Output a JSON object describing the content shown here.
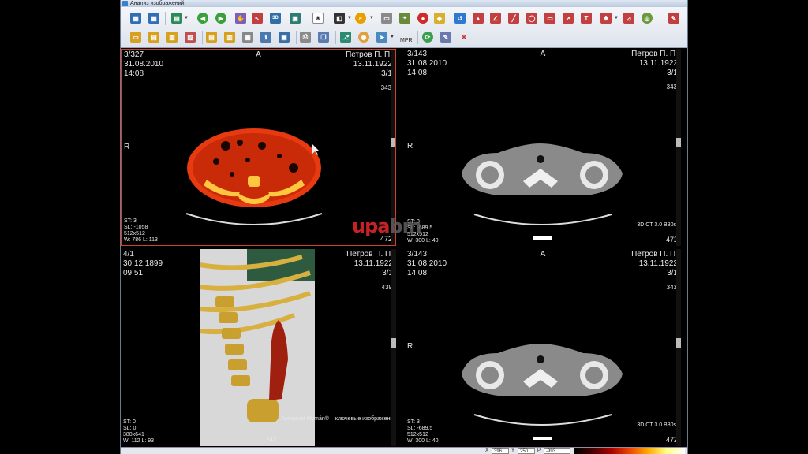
{
  "window": {
    "title": "Анализ изображений"
  },
  "toolbar": {
    "mpr_label": "MPR"
  },
  "viewports": [
    {
      "series": "3/327",
      "date": "31.08.2010",
      "time": "14:08",
      "orientation_top": "A",
      "orientation_left": "R",
      "patient": "Петров П. П.",
      "birthdate": "13.11.1922",
      "index": "3/1",
      "count": "343",
      "st": "ST: 3",
      "sl": "SL: -1058",
      "matrix": "512x512",
      "wl": "W: 786 L: 113",
      "bottom_number": "472",
      "protocol": ""
    },
    {
      "series": "3/143",
      "date": "31.08.2010",
      "time": "14:08",
      "orientation_top": "A",
      "orientation_left": "R",
      "patient": "Петров П. П.",
      "birthdate": "13.11.1922",
      "index": "3/1",
      "count": "343",
      "st": "ST: 3",
      "sl": "SL: -689.5",
      "matrix": "512x512",
      "wl": "W: 300 L: 40",
      "bottom_number": "472",
      "protocol": "3D CT 3.0 B30s"
    },
    {
      "series": "4/1",
      "date": "30.12.1899",
      "time": "09:51",
      "orientation_top": "",
      "orientation_left": "",
      "patient": "Петров П. П.",
      "birthdate": "13.11.1922",
      "index": "3/1",
      "count": "439",
      "st": "ST: 0",
      "sl": "SL: 0",
      "matrix": "380x641",
      "wl": "W: 112 L: 93",
      "bottom_number": "242",
      "protocol": "",
      "caption": "Алгоритм Mymán® – ключевые изображения"
    },
    {
      "series": "3/143",
      "date": "31.08.2010",
      "time": "14:08",
      "orientation_top": "A",
      "orientation_left": "R",
      "patient": "Петров П. П.",
      "birthdate": "13.11.1922",
      "index": "3/1",
      "count": "343",
      "st": "ST: 3",
      "sl": "SL: -689.5",
      "matrix": "512x512",
      "wl": "W: 300 L: 40",
      "bottom_number": "472",
      "protocol": "3D CT 3.0 B30s"
    }
  ],
  "watermark": {
    "red": "upa",
    "grey": "bm"
  },
  "statusbar": {
    "x_label": "X",
    "x_value": "396",
    "y_label": "Y",
    "y_value": "250",
    "p_label": "P",
    "p_value": "-993"
  },
  "colors": {
    "accent": "#d0402c",
    "toolbar_bg": "#e6ebf2"
  }
}
